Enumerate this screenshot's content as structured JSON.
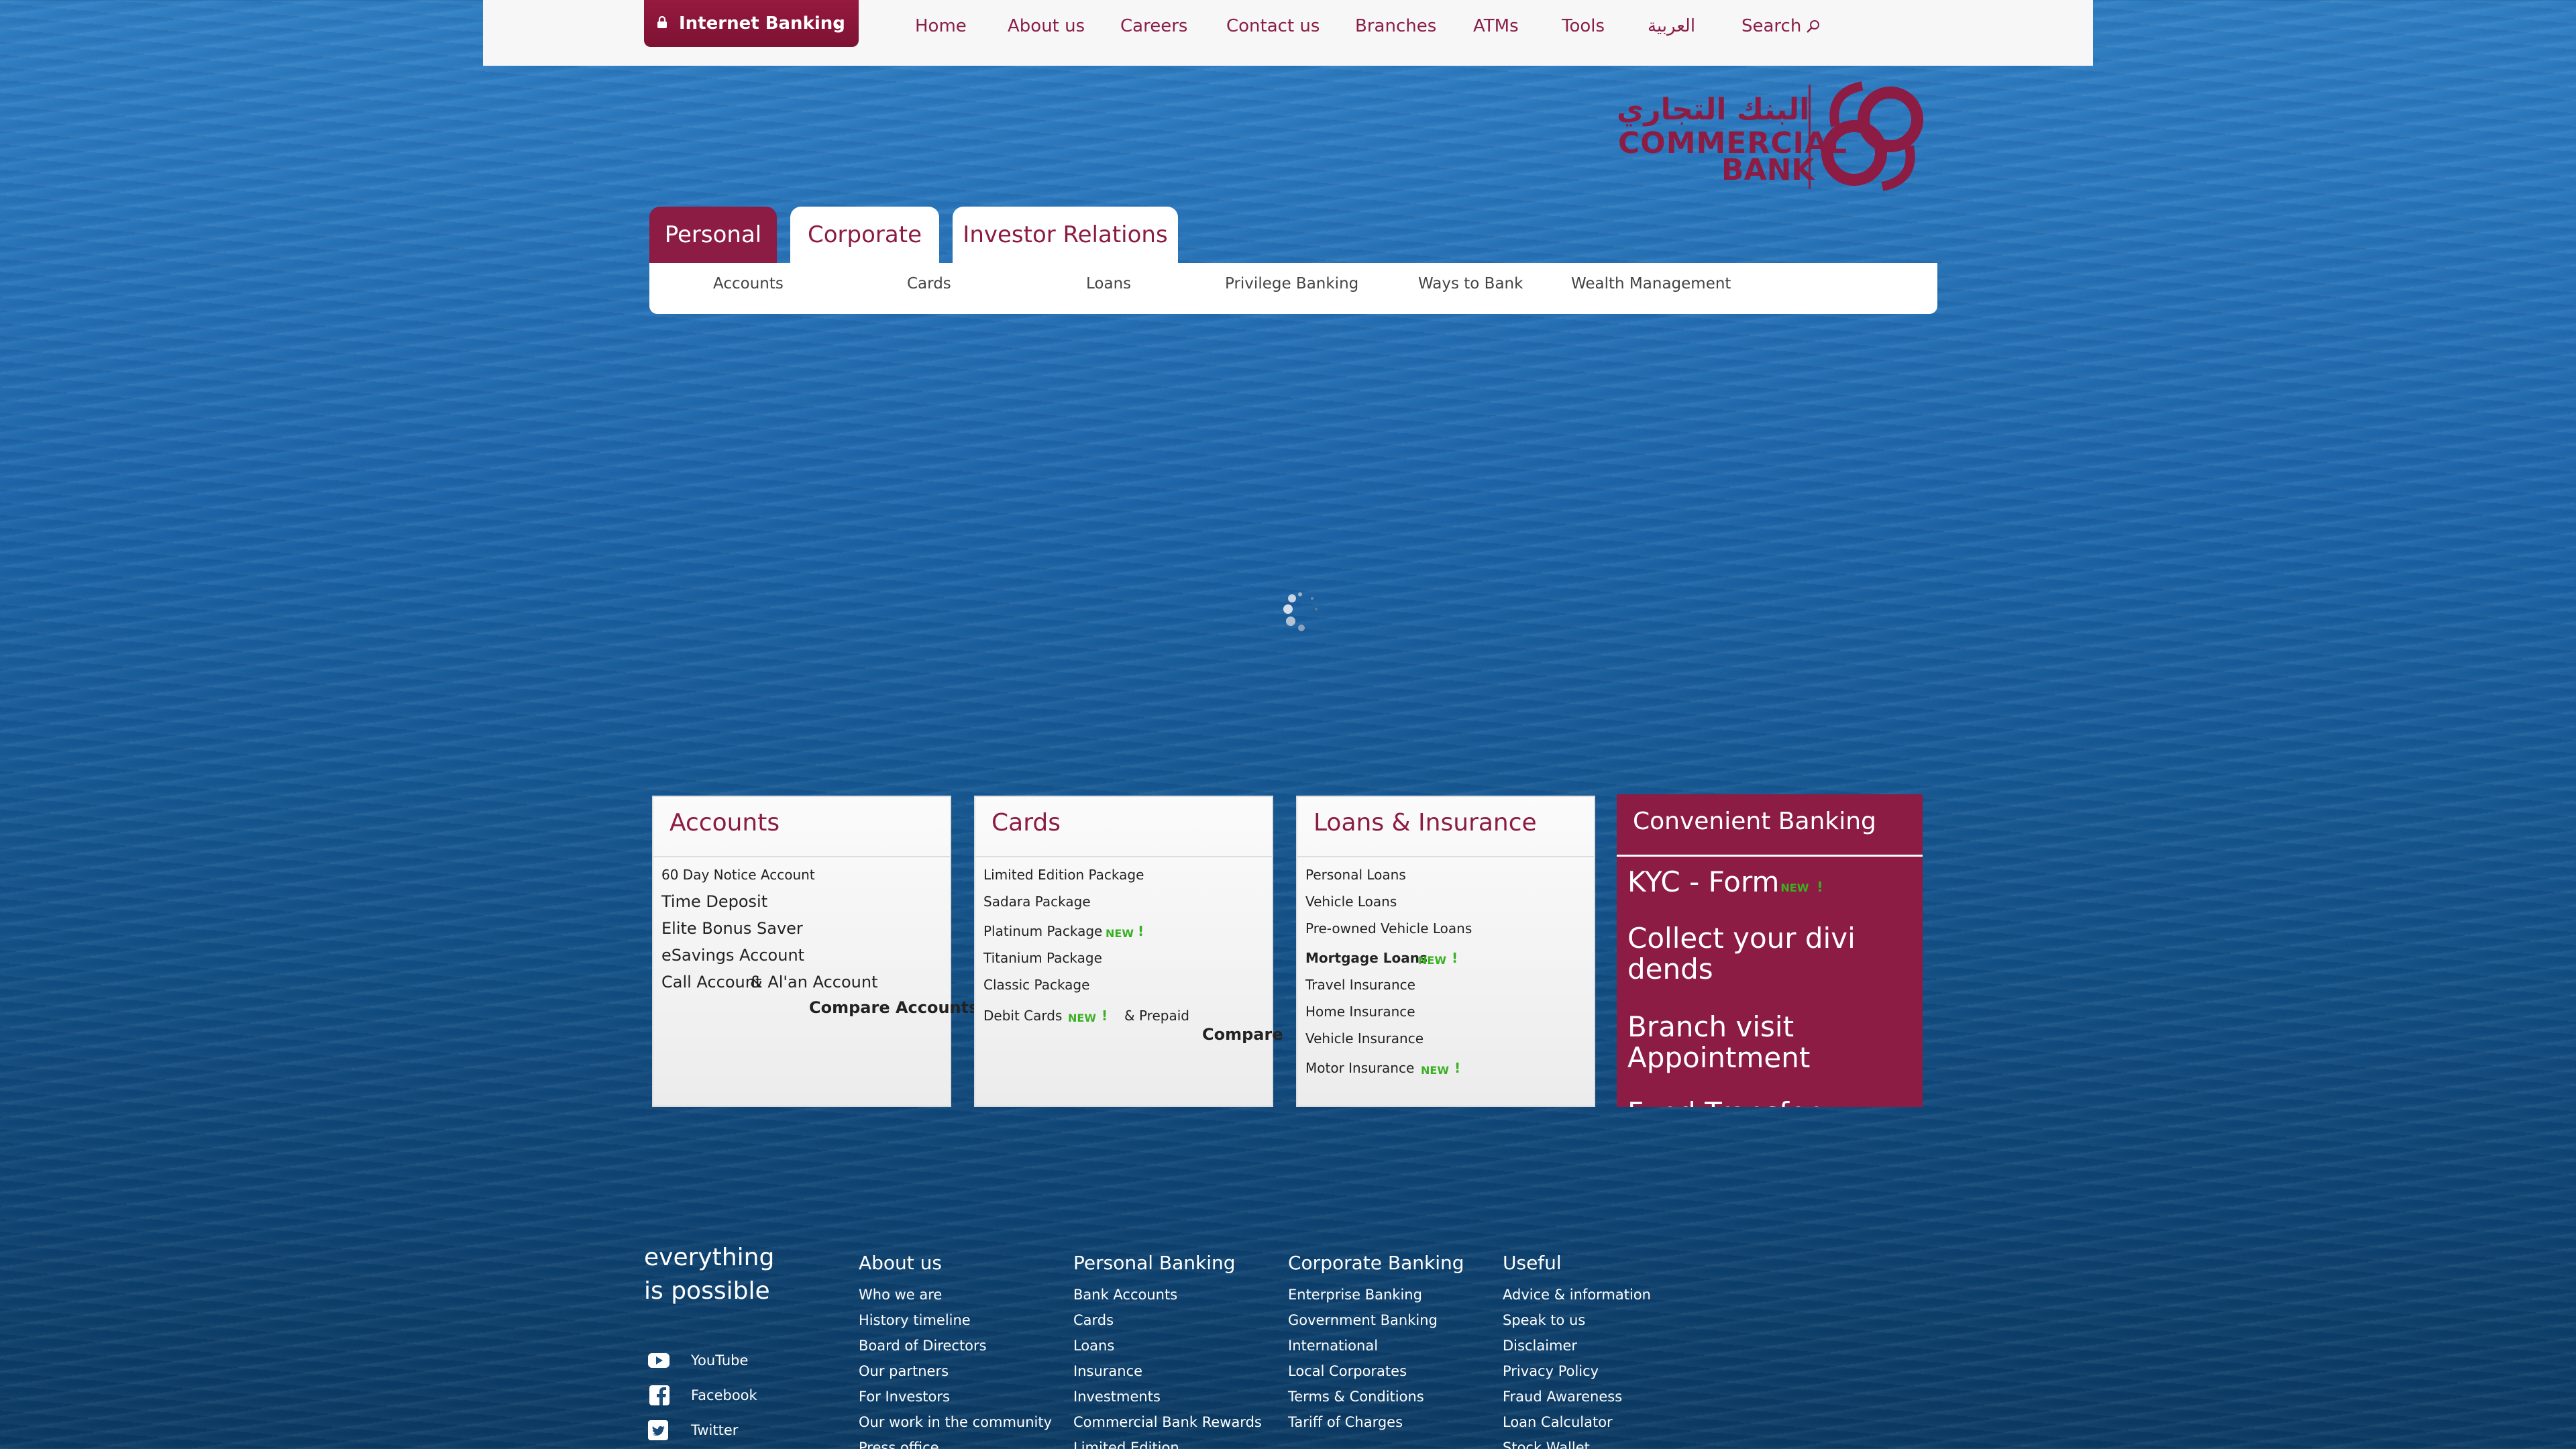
{
  "header": {
    "internet_banking": "Internet Banking",
    "nav": [
      "Home",
      "About us",
      "Careers",
      "Contact us",
      "Branches",
      "ATMs",
      "Tools",
      "العربية",
      "Search"
    ]
  },
  "logo": {
    "arabic": "البنك التجاري",
    "line1": "COMMERCIAL",
    "line2": "BANK"
  },
  "tabs": [
    "Personal",
    "Corporate",
    "Investor Relations"
  ],
  "subnav": [
    "Accounts",
    "Cards",
    "Loans",
    "Privilege Banking",
    "Ways to Bank",
    "Wealth Management"
  ],
  "boxes": {
    "accounts": {
      "title": "Accounts",
      "links": [
        "60 Day Notice Account",
        "Time Deposit",
        "Elite Bonus Saver",
        "eSavings Account",
        "Call Account",
        "& Al'an Account"
      ],
      "compare": "Compare Accounts"
    },
    "cards": {
      "title": "Cards",
      "links": [
        "Limited Edition Package",
        "Sadara Package",
        "Platinum Package",
        "Titanium Package",
        "Classic Package",
        "Debit Cards",
        "& Prepaid"
      ],
      "compare": "Compare"
    },
    "loans": {
      "title": "Loans & Insurance",
      "links": [
        "Personal Loans",
        "Vehicle Loans",
        "Pre-owned Vehicle Loans",
        "Mortgage Loans",
        "Travel Insurance",
        "Home Insurance",
        "Vehicle Insurance",
        "Motor Insurance"
      ]
    },
    "new_badge": "NEW",
    "new_mark": "!"
  },
  "convenient": {
    "title": "Convenient Banking",
    "items": [
      "KYC - Form",
      "Collect your divi dends",
      "Branch visit Appointment",
      "Fund Transfer"
    ]
  },
  "footer": {
    "tagline1": "everything",
    "tagline2": "is possible",
    "social": [
      "YouTube",
      "Facebook",
      "Twitter"
    ],
    "about": {
      "title": "About us",
      "links": [
        "Who we are",
        "History timeline",
        "Board of Directors",
        "Our partners",
        "For Investors",
        "Our work in the community",
        "Press office"
      ]
    },
    "personal": {
      "title": "Personal Banking",
      "links": [
        "Bank Accounts",
        "Cards",
        "Loans",
        "Insurance",
        "Investments",
        "Commercial Bank Rewards",
        "Limited Edition"
      ]
    },
    "corporate": {
      "title": "Corporate Banking",
      "links": [
        "Enterprise Banking",
        "Government Banking",
        "International",
        "Local Corporates",
        "Terms & Conditions",
        "Tariff of Charges"
      ]
    },
    "useful": {
      "title": "Useful",
      "links": [
        "Advice & information",
        "Speak to us",
        "Disclaimer",
        "Privacy Policy",
        "Fraud Awareness",
        "Loan Calculator",
        "Stock Wallet"
      ]
    }
  },
  "colors": {
    "brand": "#8c1c43",
    "new_badge": "#3ab022"
  }
}
